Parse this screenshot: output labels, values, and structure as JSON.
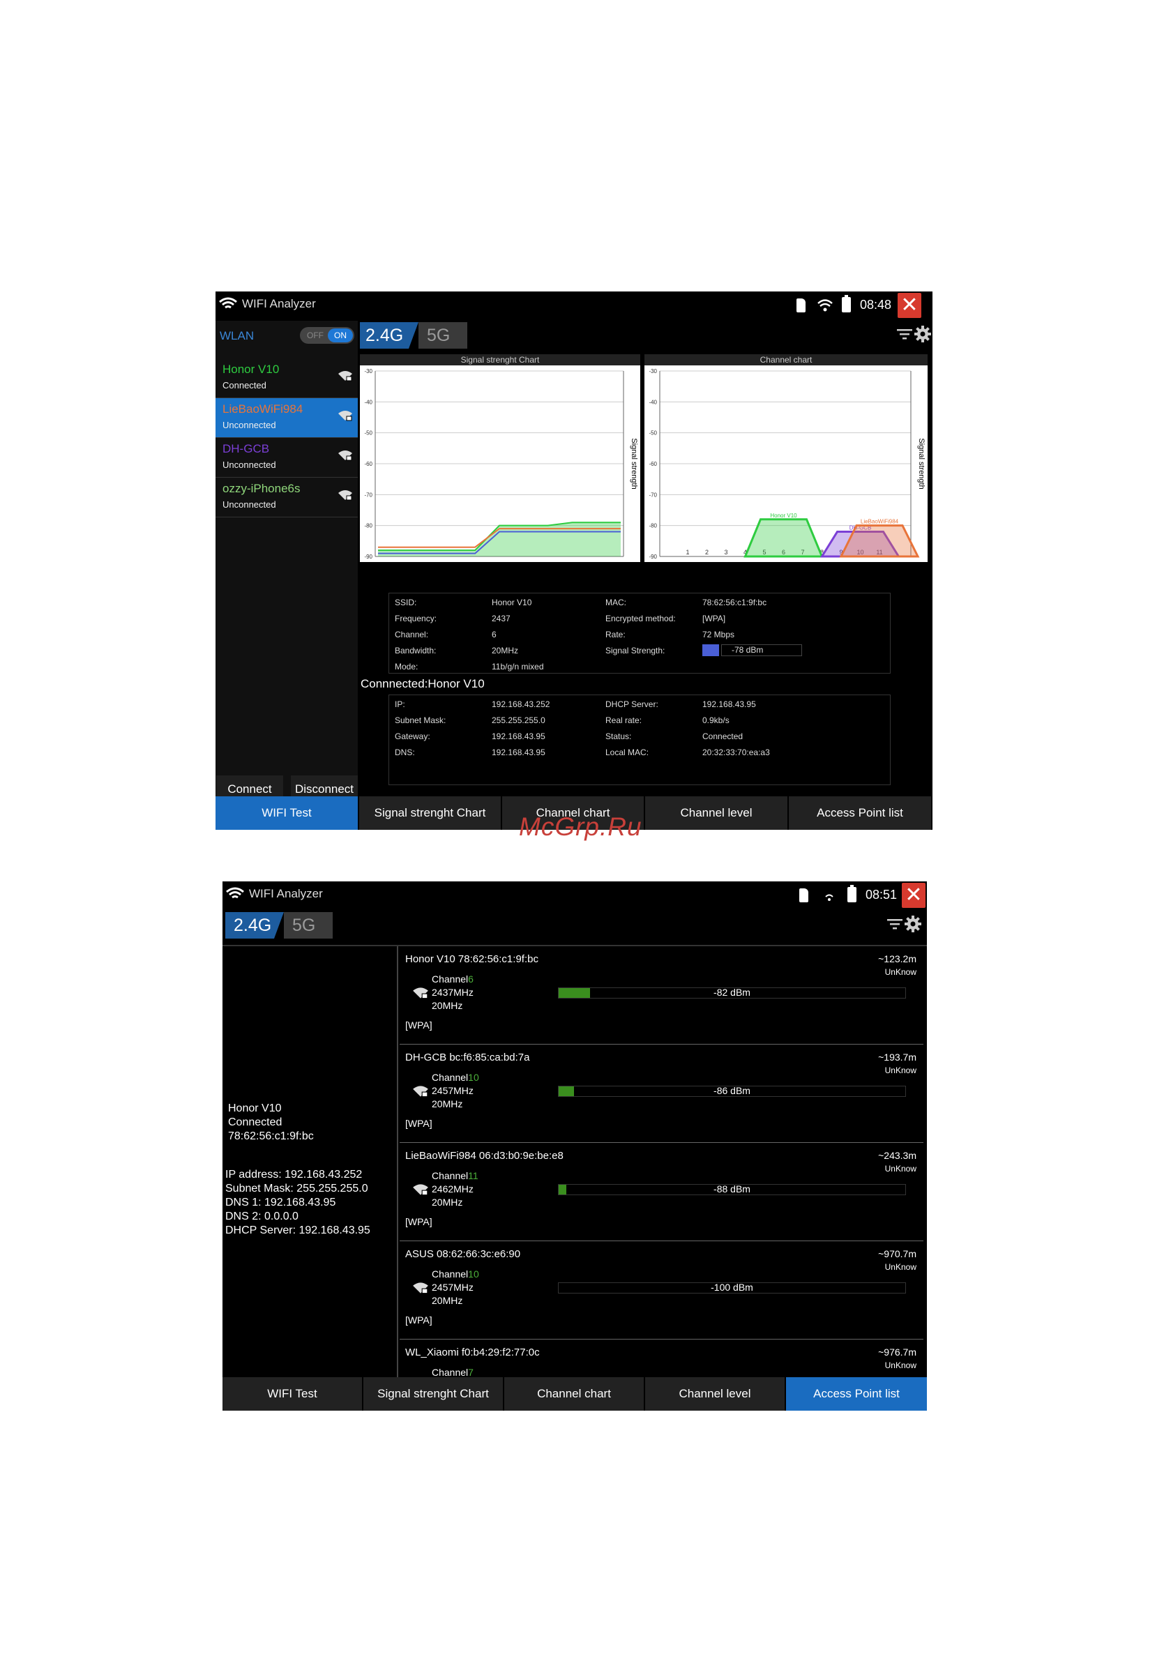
{
  "watermark": "McGrp.Ru",
  "screen1": {
    "app_title": "WIFI Analyzer",
    "time": "08:48",
    "close": "✕",
    "wlan_label": "WLAN",
    "toggle_off": "OFF",
    "toggle_on": "ON",
    "bands": [
      "2.4G",
      "5G"
    ],
    "networks": [
      {
        "ssid": "Honor V10",
        "status": "Connected",
        "color": "#2ecc40"
      },
      {
        "ssid": "LieBaoWiFi984",
        "status": "Unconnected",
        "color": "#e8743a"
      },
      {
        "ssid": "DH-GCB",
        "status": "Unconnected",
        "color": "#7b3fd6"
      },
      {
        "ssid": "ozzy-iPhone6s",
        "status": "Unconnected",
        "color": "#8fd67b"
      }
    ],
    "connect_label": "Connect",
    "disconnect_label": "Disconnect",
    "signal_chart_title": "Signal strenght Chart",
    "channel_chart_title": "Channel chart",
    "axis_label": "Signal strength",
    "details": {
      "ssid_label": "SSID:",
      "ssid": "Honor V10",
      "freq_label": "Frequency:",
      "freq": "2437",
      "channel_label": "Channel:",
      "channel": "6",
      "bw_label": "Bandwidth:",
      "bw": "20MHz",
      "mode_label": "Mode:",
      "mode": "11b/g/n mixed",
      "mac_label": "MAC:",
      "mac": "78:62:56:c1:9f:bc",
      "enc_label": "Encrypted method:",
      "enc": "[WPA]",
      "rate_label": "Rate:",
      "rate": "72 Mbps",
      "sig_label": "Signal Strength:",
      "sig": "-78 dBm"
    },
    "connected_heading": "Connnected:Honor V10",
    "conn": {
      "ip_label": "IP:",
      "ip": "192.168.43.252",
      "mask_label": "Subnet Mask:",
      "mask": "255.255.255.0",
      "gw_label": "Gateway:",
      "gw": "192.168.43.95",
      "dns_label": "DNS:",
      "dns": "192.168.43.95",
      "dhcp_label": "DHCP Server:",
      "dhcp": "192.168.43.95",
      "real_label": "Real rate:",
      "real": "0.9kb/s",
      "status_label": "Status:",
      "status": "Connected",
      "lmac_label": "Local MAC:",
      "lmac": "20:32:33:70:ea:a3"
    },
    "nav": [
      "WIFI Test",
      "Signal strenght Chart",
      "Channel chart",
      "Channel level",
      "Access Point list"
    ],
    "active_nav": 0
  },
  "chart_data": [
    {
      "type": "area",
      "title": "Signal strenght Chart",
      "ylabel": "Signal strength",
      "ylim": [
        -90,
        -30
      ],
      "yticks": [
        -30,
        -40,
        -50,
        -60,
        -70,
        -80,
        -90
      ],
      "series": [
        {
          "color": "#2ecc40",
          "values": [
            -88,
            -88,
            -88,
            -88,
            -88,
            -80,
            -80,
            -80,
            -79,
            -79,
            -79
          ]
        },
        {
          "color": "#4a5fd6",
          "values": [
            -89,
            -89,
            -89,
            -89,
            -89,
            -82,
            -82,
            -82,
            -82,
            -82,
            -82
          ]
        },
        {
          "color": "#e8743a",
          "values": [
            -87,
            -87,
            -87,
            -87,
            -87,
            -81,
            -81,
            -81,
            -81,
            -81,
            -81
          ]
        }
      ]
    },
    {
      "type": "area",
      "title": "Channel chart",
      "ylabel": "Signal strength",
      "ylim": [
        -90,
        -30
      ],
      "yticks": [
        -30,
        -40,
        -50,
        -60,
        -70,
        -80,
        -90
      ],
      "categories": [
        "1",
        "2",
        "3",
        "4",
        "5",
        "6",
        "7",
        "8",
        "9",
        "10",
        "11"
      ],
      "series": [
        {
          "name": "Honor V10",
          "channel": 6,
          "value": -78,
          "color": "#2ecc40"
        },
        {
          "name": "DH-GCB",
          "channel": 10,
          "value": -82,
          "color": "#7b3fd6"
        },
        {
          "name": "LieBaoWiFi984",
          "channel": 11,
          "value": -80,
          "color": "#e8743a"
        }
      ]
    }
  ],
  "screen2": {
    "app_title": "WIFI Analyzer",
    "time": "08:51",
    "close": "✕",
    "bands": [
      "2.4G",
      "5G"
    ],
    "side": {
      "name": "Honor V10",
      "status": "Connected",
      "mac": "78:62:56:c1:9f:bc",
      "ip": "IP address: 192.168.43.252",
      "mask": "Subnet Mask: 255.255.255.0",
      "dns1": "DNS 1: 192.168.43.95",
      "dns2": "DNS 2: 0.0.0.0",
      "dhcp": "DHCP Server: 192.168.43.95"
    },
    "aps": [
      {
        "header": "Honor V10  78:62:56:c1:9f:bc",
        "dist": "~123.2m",
        "vendor": "UnKnow",
        "ch_label": "Channel",
        "channel": "6",
        "freq": "2437MHz",
        "bw": "20MHz",
        "enc": "[WPA]",
        "dbm": "-82 dBm",
        "level": 0.09
      },
      {
        "header": "DH-GCB  bc:f6:85:ca:bd:7a",
        "dist": "~193.7m",
        "vendor": "UnKnow",
        "ch_label": "Channel",
        "channel": "10",
        "freq": "2457MHz",
        "bw": "20MHz",
        "enc": "[WPA]",
        "dbm": "-86 dBm",
        "level": 0.045
      },
      {
        "header": "LieBaoWiFi984  06:d3:b0:9e:be:e8",
        "dist": "~243.3m",
        "vendor": "UnKnow",
        "ch_label": "Channel",
        "channel": "11",
        "freq": "2462MHz",
        "bw": "20MHz",
        "enc": "[WPA]",
        "dbm": "-88 dBm",
        "level": 0.022
      },
      {
        "header": "ASUS  08:62:66:3c:e6:90",
        "dist": "~970.7m",
        "vendor": "UnKnow",
        "ch_label": "Channel",
        "channel": "10",
        "freq": "2457MHz",
        "bw": "20MHz",
        "enc": "[WPA]",
        "dbm": "-100 dBm",
        "level": 0
      },
      {
        "header": "WL_Xiaomi  f0:b4:29:f2:77:0c",
        "dist": "~976.7m",
        "vendor": "UnKnow",
        "ch_label": "Channel",
        "channel": "7",
        "freq": "",
        "bw": "",
        "enc": "",
        "dbm": "",
        "level": 0
      }
    ],
    "nav": [
      "WIFI Test",
      "Signal strenght Chart",
      "Channel chart",
      "Channel level",
      "Access Point list"
    ],
    "active_nav": 4
  }
}
